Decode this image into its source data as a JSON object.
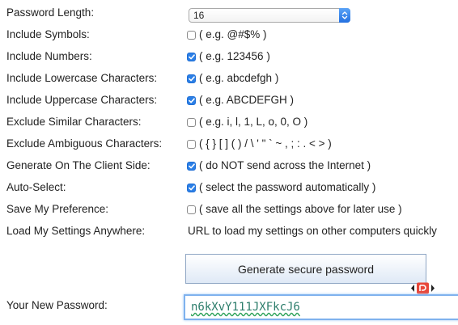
{
  "options": [
    {
      "id": "length",
      "label": "Password Length:",
      "type": "select",
      "value": "16"
    },
    {
      "id": "symbols",
      "label": "Include Symbols:",
      "type": "checkbox",
      "checked": false,
      "hint": "( e.g. @#$% )"
    },
    {
      "id": "numbers",
      "label": "Include Numbers:",
      "type": "checkbox",
      "checked": true,
      "hint": "( e.g. 123456 )"
    },
    {
      "id": "lowercase",
      "label": "Include Lowercase Characters:",
      "type": "checkbox",
      "checked": true,
      "hint": "( e.g. abcdefgh )"
    },
    {
      "id": "uppercase",
      "label": "Include Uppercase Characters:",
      "type": "checkbox",
      "checked": true,
      "hint": "( e.g. ABCDEFGH )"
    },
    {
      "id": "similar",
      "label": "Exclude Similar Characters:",
      "type": "checkbox",
      "checked": false,
      "hint": "( e.g. i, l, 1, L, o, 0, O )"
    },
    {
      "id": "ambiguous",
      "label": "Exclude Ambiguous Characters:",
      "type": "checkbox",
      "checked": false,
      "hint": "( { } [ ] ( ) / \\ ' \" ` ~ , ; : . < > )"
    },
    {
      "id": "client",
      "label": "Generate On The Client Side:",
      "type": "checkbox",
      "checked": true,
      "hint": "( do NOT send across the Internet )"
    },
    {
      "id": "autoselect",
      "label": "Auto-Select:",
      "type": "checkbox",
      "checked": true,
      "hint": "( select the password automatically )"
    },
    {
      "id": "savepref",
      "label": "Save My Preference:",
      "type": "checkbox",
      "checked": false,
      "hint": "( save all the settings above for later use )"
    },
    {
      "id": "load",
      "label": "Load My Settings Anywhere:",
      "type": "text",
      "hint": "URL to load my settings on other computers quickly"
    }
  ],
  "generate_button_label": "Generate secure password",
  "new_password_label": "Your New Password:",
  "new_password_value": "n6kXvY111JXFkcJ6",
  "colors": {
    "checkbox_on": "#2b7fe6",
    "button_border": "#8fa6c4",
    "field_border": "#7fb2ee",
    "password_text": "#2c7d6b"
  },
  "icons": {
    "select_arrows": "updown-chevron-icon",
    "checkbox_check": "checkmark-icon",
    "extension": "extension-icon"
  }
}
